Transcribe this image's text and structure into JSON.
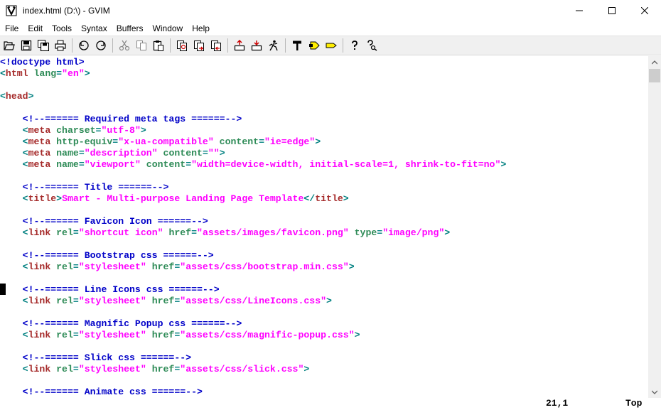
{
  "window": {
    "title": "index.html (D:\\) - GVIM",
    "minimize_glyph": "—",
    "maximize_glyph": "☐",
    "close_glyph": "✕"
  },
  "menu": [
    "File",
    "Edit",
    "Tools",
    "Syntax",
    "Buffers",
    "Window",
    "Help"
  ],
  "toolbar": {
    "icons": [
      "open-icon",
      "save-icon",
      "save-all-icon",
      "print-icon",
      "undo-icon",
      "redo-icon",
      "cut-icon",
      "copy-icon",
      "paste-icon",
      "replace-icon",
      "find-next-icon",
      "find-prev-icon",
      "load-session-icon",
      "save-session-icon",
      "run-script-icon",
      "make-icon",
      "run-ctags-icon",
      "jump-tag-icon",
      "help-icon",
      "find-help-icon"
    ]
  },
  "editor": {
    "lines": [
      [
        [
          "c-doctype",
          "<!doctype html>"
        ]
      ],
      [
        [
          "c-tag",
          "<"
        ],
        [
          "c-tagname",
          "html"
        ],
        [
          "c-attr",
          " lang"
        ],
        [
          "c-tag",
          "="
        ],
        [
          "c-str",
          "\"en\""
        ],
        [
          "c-tag",
          ">"
        ]
      ],
      [],
      [
        [
          "c-tag",
          "<"
        ],
        [
          "c-tagname",
          "head"
        ],
        [
          "c-tag",
          ">"
        ]
      ],
      [],
      [
        [
          "",
          "    "
        ],
        [
          "c-comment",
          "<!--====== Required meta tags ======-->"
        ]
      ],
      [
        [
          "",
          "    "
        ],
        [
          "c-tag",
          "<"
        ],
        [
          "c-tagname",
          "meta"
        ],
        [
          "c-attr",
          " charset"
        ],
        [
          "c-tag",
          "="
        ],
        [
          "c-str",
          "\"utf-8\""
        ],
        [
          "c-tag",
          ">"
        ]
      ],
      [
        [
          "",
          "    "
        ],
        [
          "c-tag",
          "<"
        ],
        [
          "c-tagname",
          "meta"
        ],
        [
          "c-attr",
          " http-equiv"
        ],
        [
          "c-tag",
          "="
        ],
        [
          "c-str",
          "\"x-ua-compatible\""
        ],
        [
          "c-attr",
          " content"
        ],
        [
          "c-tag",
          "="
        ],
        [
          "c-str",
          "\"ie=edge\""
        ],
        [
          "c-tag",
          ">"
        ]
      ],
      [
        [
          "",
          "    "
        ],
        [
          "c-tag",
          "<"
        ],
        [
          "c-tagname",
          "meta"
        ],
        [
          "c-attr",
          " name"
        ],
        [
          "c-tag",
          "="
        ],
        [
          "c-str",
          "\"description\""
        ],
        [
          "c-attr",
          " content"
        ],
        [
          "c-tag",
          "="
        ],
        [
          "c-str",
          "\"\""
        ],
        [
          "c-tag",
          ">"
        ]
      ],
      [
        [
          "",
          "    "
        ],
        [
          "c-tag",
          "<"
        ],
        [
          "c-tagname",
          "meta"
        ],
        [
          "c-attr",
          " name"
        ],
        [
          "c-tag",
          "="
        ],
        [
          "c-str",
          "\"viewport\""
        ],
        [
          "c-attr",
          " content"
        ],
        [
          "c-tag",
          "="
        ],
        [
          "c-str",
          "\"width=device-width, initial-scale=1, shrink-to-fit=no\""
        ],
        [
          "c-tag",
          ">"
        ]
      ],
      [],
      [
        [
          "",
          "    "
        ],
        [
          "c-comment",
          "<!--====== Title ======-->"
        ]
      ],
      [
        [
          "",
          "    "
        ],
        [
          "c-tag",
          "<"
        ],
        [
          "c-tagname",
          "title"
        ],
        [
          "c-tag",
          ">"
        ],
        [
          "c-title",
          "Smart - Multi-purpose Landing Page Template"
        ],
        [
          "c-tag",
          "</"
        ],
        [
          "c-tagname",
          "title"
        ],
        [
          "c-tag",
          ">"
        ]
      ],
      [],
      [
        [
          "",
          "    "
        ],
        [
          "c-comment",
          "<!--====== Favicon Icon ======-->"
        ]
      ],
      [
        [
          "",
          "    "
        ],
        [
          "c-tag",
          "<"
        ],
        [
          "c-tagname",
          "link"
        ],
        [
          "c-attr",
          " rel"
        ],
        [
          "c-tag",
          "="
        ],
        [
          "c-str",
          "\"shortcut icon\""
        ],
        [
          "c-attr",
          " href"
        ],
        [
          "c-tag",
          "="
        ],
        [
          "c-str",
          "\"assets/images/favicon.png\""
        ],
        [
          "c-attr",
          " type"
        ],
        [
          "c-tag",
          "="
        ],
        [
          "c-str",
          "\"image/png\""
        ],
        [
          "c-tag",
          ">"
        ]
      ],
      [],
      [
        [
          "",
          "    "
        ],
        [
          "c-comment",
          "<!--====== Bootstrap css ======-->"
        ]
      ],
      [
        [
          "",
          "    "
        ],
        [
          "c-tag",
          "<"
        ],
        [
          "c-tagname",
          "link"
        ],
        [
          "c-attr",
          " rel"
        ],
        [
          "c-tag",
          "="
        ],
        [
          "c-str",
          "\"stylesheet\""
        ],
        [
          "c-attr",
          " href"
        ],
        [
          "c-tag",
          "="
        ],
        [
          "c-str",
          "\"assets/css/bootstrap.min.css\""
        ],
        [
          "c-tag",
          ">"
        ]
      ],
      [],
      [
        [
          "",
          "    "
        ],
        [
          "c-comment",
          "<!--====== Line Icons css ======-->"
        ]
      ],
      [
        [
          "",
          "    "
        ],
        [
          "c-tag",
          "<"
        ],
        [
          "c-tagname",
          "link"
        ],
        [
          "c-attr",
          " rel"
        ],
        [
          "c-tag",
          "="
        ],
        [
          "c-str",
          "\"stylesheet\""
        ],
        [
          "c-attr",
          " href"
        ],
        [
          "c-tag",
          "="
        ],
        [
          "c-str",
          "\"assets/css/LineIcons.css\""
        ],
        [
          "c-tag",
          ">"
        ]
      ],
      [],
      [
        [
          "",
          "    "
        ],
        [
          "c-comment",
          "<!--====== Magnific Popup css ======-->"
        ]
      ],
      [
        [
          "",
          "    "
        ],
        [
          "c-tag",
          "<"
        ],
        [
          "c-tagname",
          "link"
        ],
        [
          "c-attr",
          " rel"
        ],
        [
          "c-tag",
          "="
        ],
        [
          "c-str",
          "\"stylesheet\""
        ],
        [
          "c-attr",
          " href"
        ],
        [
          "c-tag",
          "="
        ],
        [
          "c-str",
          "\"assets/css/magnific-popup.css\""
        ],
        [
          "c-tag",
          ">"
        ]
      ],
      [],
      [
        [
          "",
          "    "
        ],
        [
          "c-comment",
          "<!--====== Slick css ======-->"
        ]
      ],
      [
        [
          "",
          "    "
        ],
        [
          "c-tag",
          "<"
        ],
        [
          "c-tagname",
          "link"
        ],
        [
          "c-attr",
          " rel"
        ],
        [
          "c-tag",
          "="
        ],
        [
          "c-str",
          "\"stylesheet\""
        ],
        [
          "c-attr",
          " href"
        ],
        [
          "c-tag",
          "="
        ],
        [
          "c-str",
          "\"assets/css/slick.css\""
        ],
        [
          "c-tag",
          ">"
        ]
      ],
      [],
      [
        [
          "",
          "    "
        ],
        [
          "c-comment",
          "<!--====== Animate css ======-->"
        ]
      ]
    ]
  },
  "status": {
    "cursor_position": "21,1",
    "scroll_position": "Top"
  }
}
